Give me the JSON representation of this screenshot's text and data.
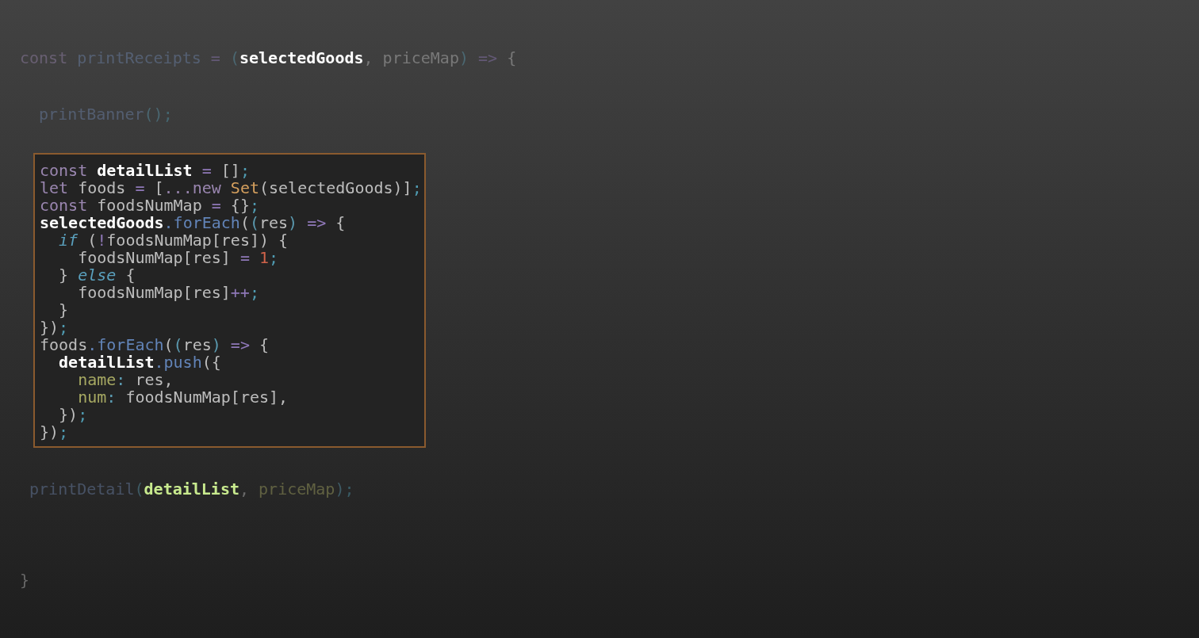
{
  "code_before": [
    {
      "dimmed": true,
      "tokens": [
        {
          "kind": "keyword",
          "text": "const "
        },
        {
          "kind": "func",
          "text": "printReceipts"
        },
        {
          "kind": "operator",
          "text": " = "
        },
        {
          "kind": "paren",
          "text": "("
        },
        {
          "kind": "focus",
          "text": "selectedGoods"
        },
        {
          "kind": "plain",
          "text": ", priceMap"
        },
        {
          "kind": "paren",
          "text": ")"
        },
        {
          "kind": "operator",
          "text": " => "
        },
        {
          "kind": "plain",
          "text": "{"
        }
      ]
    },
    {
      "dimmed": true,
      "tokens": [
        {
          "kind": "func",
          "text": "  printBanner"
        },
        {
          "kind": "paren",
          "text": "()"
        },
        {
          "kind": "semicolon",
          "text": ";"
        }
      ]
    }
  ],
  "highlight_box": {
    "lines": [
      {
        "dimmed": false,
        "tokens": [
          {
            "kind": "keyword",
            "text": "const "
          },
          {
            "kind": "focus",
            "text": "detailList"
          },
          {
            "kind": "operator",
            "text": " = "
          },
          {
            "kind": "plain",
            "text": "[]"
          },
          {
            "kind": "semicolon",
            "text": ";"
          }
        ]
      },
      {
        "dimmed": false,
        "tokens": [
          {
            "kind": "keyword",
            "text": "let "
          },
          {
            "kind": "plain",
            "text": "foods "
          },
          {
            "kind": "operator",
            "text": "= "
          },
          {
            "kind": "plain",
            "text": "["
          },
          {
            "kind": "keyword",
            "text": "...new "
          },
          {
            "kind": "class",
            "text": "Set"
          },
          {
            "kind": "plain",
            "text": "(selectedGoods)]"
          },
          {
            "kind": "semicolon",
            "text": ";"
          }
        ]
      },
      {
        "dimmed": false,
        "tokens": [
          {
            "kind": "keyword",
            "text": "const "
          },
          {
            "kind": "plain",
            "text": "foodsNumMap "
          },
          {
            "kind": "operator",
            "text": "= "
          },
          {
            "kind": "plain",
            "text": "{}"
          },
          {
            "kind": "semicolon",
            "text": ";"
          }
        ]
      },
      {
        "dimmed": false,
        "tokens": [
          {
            "kind": "focus",
            "text": "selectedGoods"
          },
          {
            "kind": "method",
            "text": ".forEach"
          },
          {
            "kind": "plain",
            "text": "("
          },
          {
            "kind": "paren",
            "text": "("
          },
          {
            "kind": "plain",
            "text": "res"
          },
          {
            "kind": "paren",
            "text": ")"
          },
          {
            "kind": "operator",
            "text": " => "
          },
          {
            "kind": "plain",
            "text": "{"
          }
        ]
      },
      {
        "dimmed": false,
        "tokens": [
          {
            "kind": "control",
            "text": "  if"
          },
          {
            "kind": "plain",
            "text": " ("
          },
          {
            "kind": "operator",
            "text": "!"
          },
          {
            "kind": "plain",
            "text": "foodsNumMap[res]) {"
          }
        ]
      },
      {
        "dimmed": false,
        "tokens": [
          {
            "kind": "plain",
            "text": "    foodsNumMap[res] "
          },
          {
            "kind": "operator",
            "text": "= "
          },
          {
            "kind": "number",
            "text": "1"
          },
          {
            "kind": "semicolon",
            "text": ";"
          }
        ]
      },
      {
        "dimmed": false,
        "tokens": [
          {
            "kind": "plain",
            "text": "  } "
          },
          {
            "kind": "control",
            "text": "else"
          },
          {
            "kind": "plain",
            "text": " {"
          }
        ]
      },
      {
        "dimmed": false,
        "tokens": [
          {
            "kind": "plain",
            "text": "    foodsNumMap[res]"
          },
          {
            "kind": "operator",
            "text": "++"
          },
          {
            "kind": "semicolon",
            "text": ";"
          }
        ]
      },
      {
        "dimmed": false,
        "tokens": [
          {
            "kind": "plain",
            "text": "  }"
          }
        ]
      },
      {
        "dimmed": false,
        "tokens": [
          {
            "kind": "plain",
            "text": "})"
          },
          {
            "kind": "semicolon",
            "text": ";"
          }
        ]
      },
      {
        "dimmed": false,
        "tokens": [
          {
            "kind": "plain",
            "text": "foods"
          },
          {
            "kind": "method",
            "text": ".forEach"
          },
          {
            "kind": "plain",
            "text": "("
          },
          {
            "kind": "paren",
            "text": "("
          },
          {
            "kind": "plain",
            "text": "res"
          },
          {
            "kind": "paren",
            "text": ")"
          },
          {
            "kind": "operator",
            "text": " => "
          },
          {
            "kind": "plain",
            "text": "{"
          }
        ]
      },
      {
        "dimmed": false,
        "tokens": [
          {
            "kind": "focus",
            "text": "  detailList"
          },
          {
            "kind": "method",
            "text": ".push"
          },
          {
            "kind": "plain",
            "text": "({"
          }
        ]
      },
      {
        "dimmed": false,
        "tokens": [
          {
            "kind": "property",
            "text": "    name"
          },
          {
            "kind": "paren",
            "text": ": "
          },
          {
            "kind": "plain",
            "text": "res,"
          }
        ]
      },
      {
        "dimmed": false,
        "tokens": [
          {
            "kind": "property",
            "text": "    num"
          },
          {
            "kind": "paren",
            "text": ": "
          },
          {
            "kind": "plain",
            "text": "foodsNumMap[res],"
          }
        ]
      },
      {
        "dimmed": false,
        "tokens": [
          {
            "kind": "plain",
            "text": "  })"
          },
          {
            "kind": "semicolon",
            "text": ";"
          }
        ]
      },
      {
        "dimmed": false,
        "tokens": [
          {
            "kind": "plain",
            "text": "})"
          },
          {
            "kind": "semicolon",
            "text": ";"
          }
        ]
      }
    ]
  },
  "code_after": [
    {
      "dimmed": true,
      "tokens": [
        {
          "kind": "func",
          "text": " printDetail"
        },
        {
          "kind": "paren",
          "text": "("
        },
        {
          "kind": "focus-green",
          "text": "detailList"
        },
        {
          "kind": "plain",
          "text": ", "
        },
        {
          "kind": "property",
          "text": "priceMap"
        },
        {
          "kind": "paren",
          "text": ")"
        },
        {
          "kind": "semicolon",
          "text": ";"
        }
      ]
    },
    {
      "dimmed": true,
      "tokens": [
        {
          "kind": "plain",
          "text": "}"
        }
      ]
    }
  ]
}
